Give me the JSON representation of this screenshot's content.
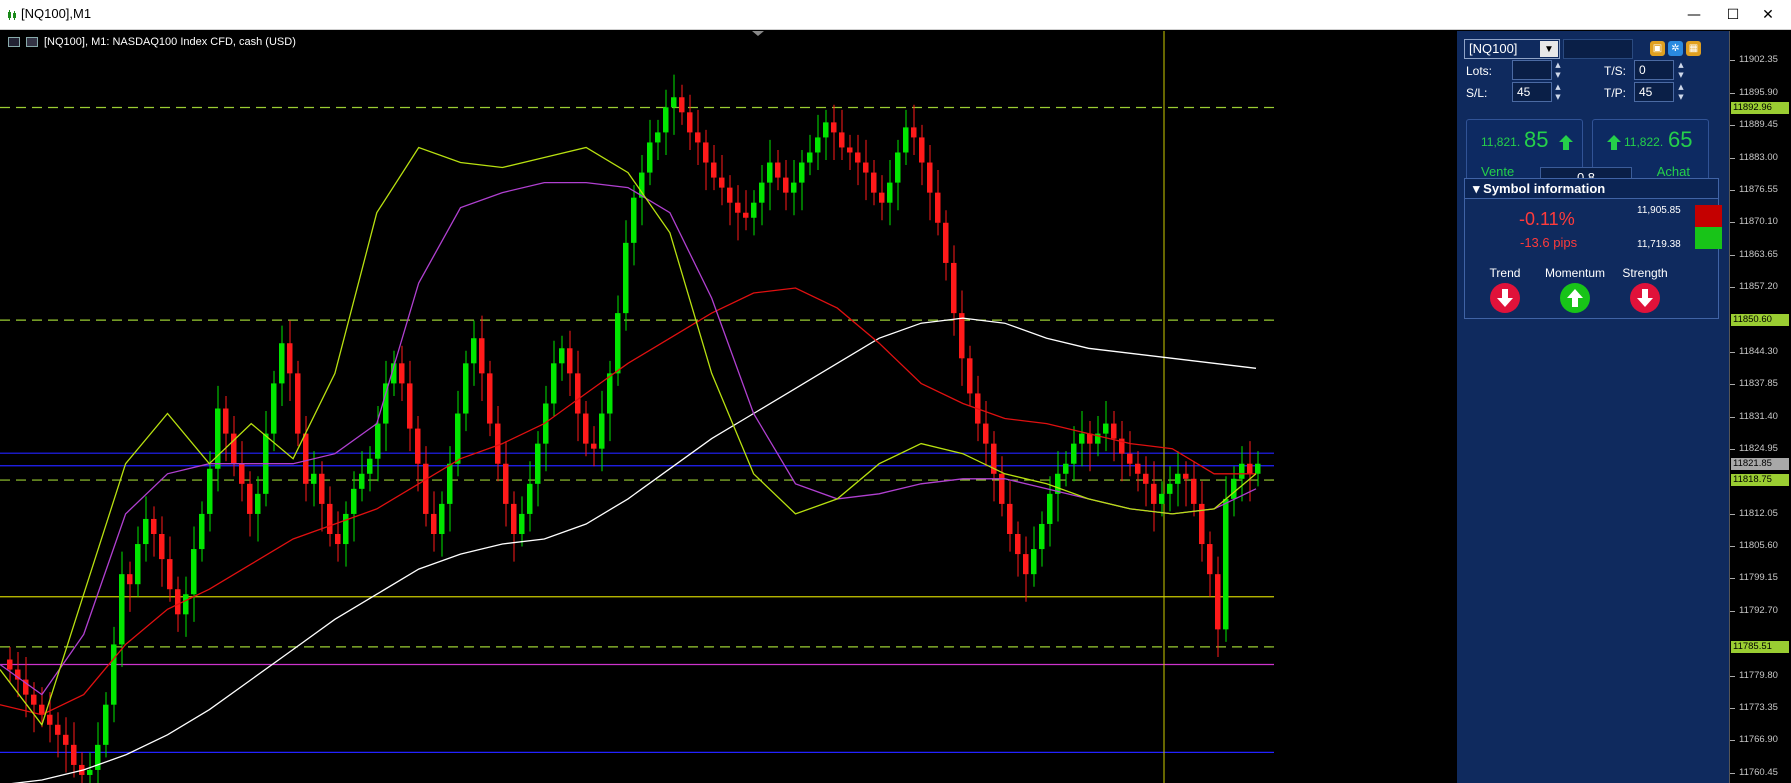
{
  "window": {
    "title": "[NQ100],M1",
    "controls": [
      "—",
      "☐",
      "✕"
    ]
  },
  "chart_header": "[NQ100], M1:  NASDAQ100 Index CFD, cash (USD)",
  "panel": {
    "symbol": "[NQ100]",
    "lots_label": "Lots:",
    "lots_value": "",
    "ts_label": "T/S:",
    "ts_value": "0",
    "sl_label": "S/L:",
    "sl_value": "45",
    "tp_label": "T/P:",
    "tp_value": "45",
    "sell": {
      "prefix": "11,821.",
      "big": "85",
      "label": "Vente"
    },
    "buy": {
      "prefix": "11,822.",
      "big": "65",
      "label": "Achat"
    },
    "spread": "0.8",
    "symbol_info": {
      "title": "Symbol information",
      "change_pct": "-0.11%",
      "change_pips": "-13.6 pips",
      "high": "11,905.85",
      "low": "11,719.38",
      "indicators": [
        {
          "label": "Trend",
          "direction": "down",
          "color": "#e0123a"
        },
        {
          "label": "Momentum",
          "direction": "up",
          "color": "#18c418"
        },
        {
          "label": "Strength",
          "direction": "down",
          "color": "#e0123a"
        }
      ]
    },
    "icons": [
      "copy-icon",
      "settings-icon",
      "layout-icon"
    ]
  },
  "axis": {
    "ticks": [
      "11902.35",
      "11895.90",
      "11889.45",
      "11883.00",
      "11876.55",
      "11870.10",
      "11863.65",
      "11857.20",
      "11850.60",
      "11844.30",
      "11837.85",
      "11831.40",
      "11824.95",
      "11821.85",
      "11818.75",
      "11812.05",
      "11805.60",
      "11799.15",
      "11792.70",
      "11785.51",
      "11779.80",
      "11773.35",
      "11766.90",
      "11760.45"
    ],
    "tags": [
      {
        "price": "11892.96",
        "color": "#9acd32"
      },
      {
        "price": "11850.60",
        "color": "#9acd32"
      },
      {
        "price": "11821.85",
        "color": "#a8a8a8"
      },
      {
        "price": "11818.75",
        "color": "#9acd32"
      },
      {
        "price": "11785.51",
        "color": "#9acd32"
      }
    ]
  },
  "chart_data": {
    "type": "candlestick",
    "symbol": "[NQ100]",
    "timeframe": "M1",
    "ylim": [
      11758.4,
      11908.2
    ],
    "levels": [
      {
        "price": 11892.96,
        "color": "#9acd32",
        "style": "dashed"
      },
      {
        "price": 11850.6,
        "color": "#9acd32",
        "style": "dashed"
      },
      {
        "price": 11818.75,
        "color": "#9acd32",
        "style": "dashed"
      },
      {
        "price": 11785.51,
        "color": "#9acd32",
        "style": "dashed"
      },
      {
        "price": 11824.1,
        "color": "#2222ff",
        "style": "solid"
      },
      {
        "price": 11821.6,
        "color": "#2222ff",
        "style": "solid"
      },
      {
        "price": 11764.5,
        "color": "#2222ff",
        "style": "solid"
      },
      {
        "price": 11795.5,
        "color": "#cccc00",
        "style": "solid"
      },
      {
        "price": 11782.0,
        "color": "#cc33cc",
        "style": "solid"
      }
    ],
    "candle_close": [
      11781,
      11779,
      11776,
      11774,
      11772,
      11770,
      11768,
      11766,
      11762,
      11760,
      11761,
      11766,
      11774,
      11786,
      11800,
      11798,
      11806,
      11811,
      11808,
      11803,
      11797,
      11792,
      11796,
      11805,
      11812,
      11821,
      11833,
      11828,
      11822,
      11818,
      11812,
      11816,
      11828,
      11838,
      11846,
      11840,
      11828,
      11818,
      11820,
      11814,
      11808,
      11806,
      11812,
      11817,
      11820,
      11823,
      11830,
      11838,
      11842,
      11838,
      11829,
      11822,
      11812,
      11808,
      11814,
      11822,
      11832,
      11842,
      11847,
      11840,
      11830,
      11822,
      11814,
      11808,
      11812,
      11818,
      11826,
      11834,
      11842,
      11845,
      11840,
      11832,
      11826,
      11825,
      11832,
      11840,
      11852,
      11866,
      11875,
      11880,
      11886,
      11888,
      11893,
      11895,
      11892,
      11888,
      11886,
      11882,
      11879,
      11877,
      11874,
      11872,
      11871,
      11874,
      11878,
      11882,
      11879,
      11876,
      11878,
      11882,
      11884,
      11887,
      11890,
      11888,
      11885,
      11884,
      11882,
      11880,
      11876,
      11874,
      11878,
      11884,
      11889,
      11887,
      11882,
      11876,
      11870,
      11862,
      11852,
      11843,
      11836,
      11830,
      11826,
      11820,
      11814,
      11808,
      11804,
      11800,
      11805,
      11810,
      11816,
      11820,
      11822,
      11826,
      11828,
      11826,
      11828,
      11830,
      11827,
      11824,
      11822,
      11820,
      11818,
      11814,
      11816,
      11818,
      11820,
      11819,
      11814,
      11806,
      11800,
      11789,
      11815,
      11819,
      11822,
      11820,
      11822
    ],
    "ma_white": [
      11758,
      11759,
      11761,
      11764,
      11768,
      11773,
      11779,
      11785,
      11791,
      11796,
      11801,
      11804,
      11806,
      11807,
      11810,
      11815,
      11821,
      11827,
      11832,
      11837,
      11842,
      11847,
      11850,
      11851,
      11850,
      11847,
      11845,
      11844,
      11843,
      11842,
      11841
    ],
    "ma_red": [
      11774,
      11772,
      11776,
      11786,
      11793,
      11797,
      11802,
      11807,
      11810,
      11813,
      11818,
      11823,
      11826,
      11830,
      11836,
      11842,
      11847,
      11852,
      11856,
      11857,
      11853,
      11846,
      11838,
      11834,
      11831,
      11830,
      11828,
      11826,
      11825,
      11820,
      11820
    ],
    "ma_purple": [
      11782,
      11776,
      11788,
      11812,
      11820,
      11822,
      11822,
      11822,
      11824,
      11830,
      11858,
      11873,
      11876,
      11878,
      11878,
      11877,
      11872,
      11855,
      11832,
      11818,
      11815,
      11816,
      11818,
      11819,
      11819,
      11817,
      11815,
      11813,
      11812,
      11813,
      11817
    ],
    "ma_yellow": [
      11781,
      11770,
      11796,
      11822,
      11832,
      11822,
      11830,
      11823,
      11840,
      11872,
      11885,
      11882,
      11881,
      11883,
      11885,
      11880,
      11868,
      11840,
      11820,
      11812,
      11815,
      11822,
      11826,
      11824,
      11820,
      11818,
      11815,
      11813,
      11812,
      11813,
      11820
    ]
  }
}
